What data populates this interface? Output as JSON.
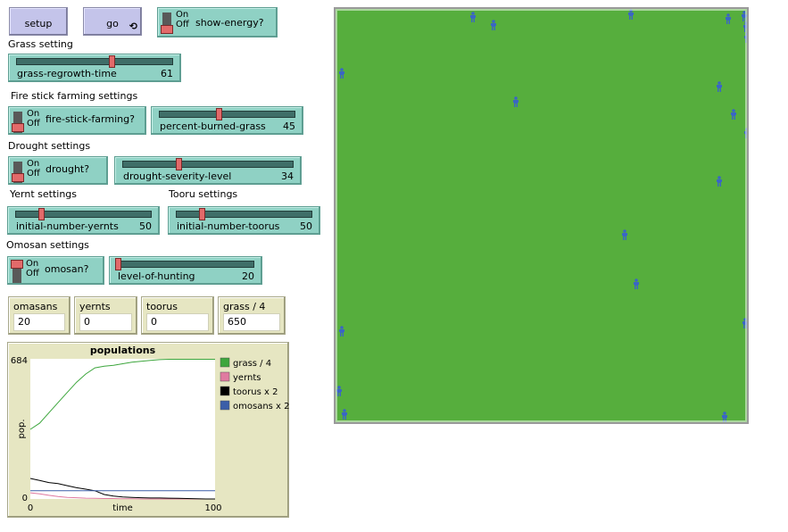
{
  "buttons": {
    "setup": "setup",
    "go": "go"
  },
  "show_energy": {
    "label": "show-energy?",
    "on": "On",
    "off": "Off",
    "state": "off"
  },
  "notes": {
    "grass": "Grass setting",
    "fire": "Fire stick farming settings",
    "drought": "Drought settings",
    "yernt": "Yernt settings",
    "tooru": "Tooru settings",
    "omosan": "Omosan settings"
  },
  "sliders": {
    "grass_regrowth_time": {
      "label": "grass-regrowth-time",
      "value": "61",
      "fraction": 0.61
    },
    "percent_burned_grass": {
      "label": "percent-burned-grass",
      "value": "45",
      "fraction": 0.45
    },
    "drought_severity_level": {
      "label": "drought-severity-level",
      "value": "34",
      "fraction": 0.34
    },
    "initial_number_yernts": {
      "label": "initial-number-yernts",
      "value": "50",
      "fraction": 0.1
    },
    "initial_number_toorus": {
      "label": "initial-number-toorus",
      "value": "50",
      "fraction": 0.21
    },
    "level_of_hunting": {
      "label": "level-of-hunting",
      "value": "20",
      "fraction": 0.0
    }
  },
  "switches": {
    "fire_stick_farming": {
      "label": "fire-stick-farming?",
      "on": "On",
      "off": "Off",
      "state": "off"
    },
    "drought": {
      "label": "drought?",
      "on": "On",
      "off": "Off",
      "state": "off"
    },
    "omosan": {
      "label": "omosan?",
      "on": "On",
      "off": "Off",
      "state": "on"
    }
  },
  "monitors": [
    {
      "label": "omasans",
      "value": "20"
    },
    {
      "label": "yernts",
      "value": "0"
    },
    {
      "label": "toorus",
      "value": "0"
    },
    {
      "label": "grass / 4",
      "value": "650"
    }
  ],
  "chart_data": {
    "type": "line",
    "title": "populations",
    "xlabel": "time",
    "ylabel": "pop.",
    "xlim": [
      0,
      100
    ],
    "ylim": [
      0,
      684
    ],
    "x_ticks": [
      "0",
      "100"
    ],
    "y_ticks": [
      "0",
      "684"
    ],
    "legend_position": "right",
    "series": [
      {
        "name": "grass / 4",
        "color": "#3da63d",
        "points": [
          [
            0,
            340
          ],
          [
            5,
            370
          ],
          [
            10,
            420
          ],
          [
            15,
            470
          ],
          [
            20,
            520
          ],
          [
            25,
            570
          ],
          [
            30,
            610
          ],
          [
            35,
            640
          ],
          [
            40,
            648
          ],
          [
            45,
            652
          ],
          [
            50,
            660
          ],
          [
            55,
            668
          ],
          [
            60,
            672
          ],
          [
            65,
            676
          ],
          [
            70,
            680
          ],
          [
            75,
            682
          ],
          [
            80,
            682
          ],
          [
            85,
            682
          ],
          [
            90,
            682
          ],
          [
            95,
            682
          ],
          [
            100,
            682
          ]
        ]
      },
      {
        "name": "yernts",
        "color": "#e07aa0",
        "points": [
          [
            0,
            30
          ],
          [
            5,
            25
          ],
          [
            10,
            18
          ],
          [
            15,
            12
          ],
          [
            20,
            8
          ],
          [
            25,
            6
          ],
          [
            30,
            4
          ],
          [
            35,
            3
          ],
          [
            40,
            2
          ],
          [
            45,
            2
          ],
          [
            50,
            1
          ],
          [
            55,
            1
          ],
          [
            60,
            0
          ],
          [
            70,
            0
          ],
          [
            80,
            0
          ],
          [
            90,
            0
          ],
          [
            100,
            0
          ]
        ]
      },
      {
        "name": "toorus x 2",
        "color": "#000000",
        "points": [
          [
            0,
            100
          ],
          [
            5,
            90
          ],
          [
            10,
            80
          ],
          [
            15,
            75
          ],
          [
            20,
            65
          ],
          [
            25,
            55
          ],
          [
            30,
            48
          ],
          [
            35,
            40
          ],
          [
            40,
            22
          ],
          [
            45,
            14
          ],
          [
            50,
            10
          ],
          [
            55,
            8
          ],
          [
            60,
            6
          ],
          [
            65,
            5
          ],
          [
            70,
            5
          ],
          [
            75,
            4
          ],
          [
            80,
            3
          ],
          [
            85,
            2
          ],
          [
            90,
            1
          ],
          [
            95,
            0
          ],
          [
            100,
            0
          ]
        ]
      },
      {
        "name": "omosans x 2",
        "color": "#3b5ea8",
        "points": [
          [
            0,
            40
          ],
          [
            10,
            40
          ],
          [
            20,
            40
          ],
          [
            30,
            40
          ],
          [
            40,
            40
          ],
          [
            50,
            40
          ],
          [
            60,
            40
          ],
          [
            70,
            40
          ],
          [
            80,
            40
          ],
          [
            90,
            40
          ],
          [
            100,
            40
          ]
        ]
      }
    ]
  },
  "world": {
    "background": "#56ae3d",
    "agent_color": "#3a66c4",
    "agent_count": 23
  }
}
